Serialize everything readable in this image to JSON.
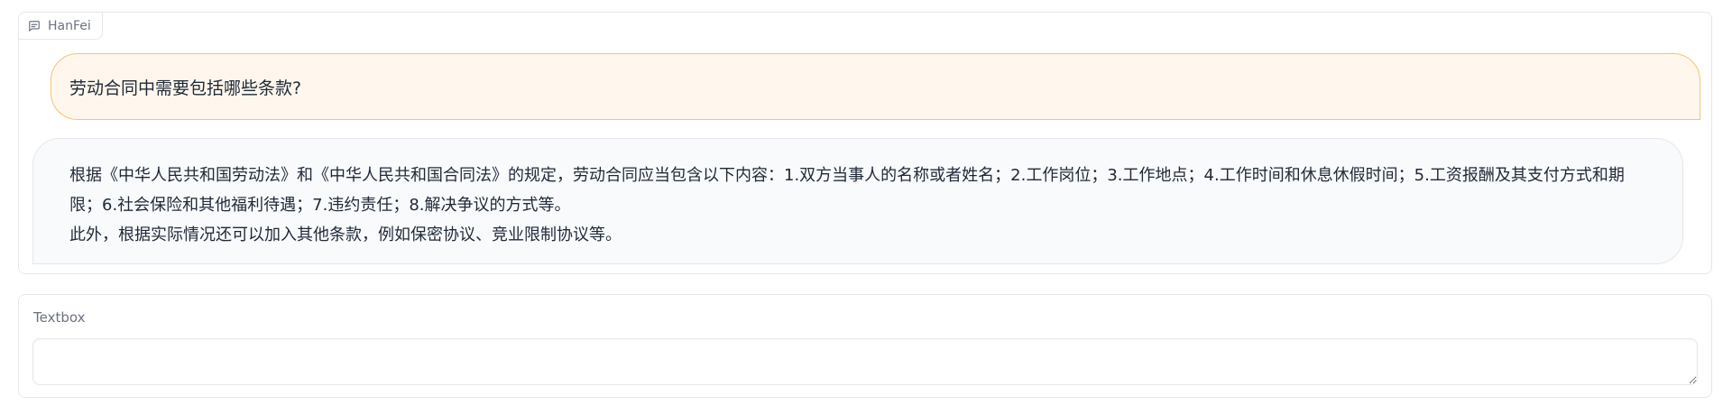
{
  "chatbot": {
    "label": "HanFei",
    "icon": "chat-icon",
    "messages": [
      {
        "role": "user",
        "text": "劳动合同中需要包括哪些条款?"
      },
      {
        "role": "bot",
        "paragraphs": [
          "根据《中华人民共和国劳动法》和《中华人民共和国合同法》的规定，劳动合同应当包含以下内容：1.双方当事人的名称或者姓名；2.工作岗位；3.工作地点；4.工作时间和休息休假时间；5.工资报酬及其支付方式和期限；6.社会保险和其他福利待遇；7.违约责任；8.解决争议的方式等。",
          "此外，根据实际情况还可以加入其他条款，例如保密协议、竞业限制协议等。"
        ]
      }
    ]
  },
  "textbox": {
    "label": "Textbox",
    "value": "",
    "placeholder": ""
  },
  "colors": {
    "user_bubble_bg": "#fff7ed",
    "user_bubble_border": "#fbbf6e",
    "bot_bubble_bg": "#f8fafc",
    "border": "#e5e7eb"
  }
}
